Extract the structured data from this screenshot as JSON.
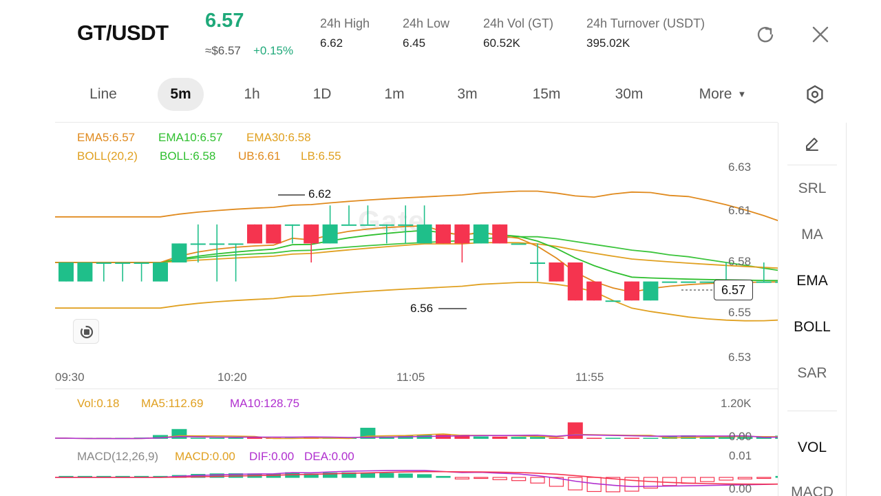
{
  "header": {
    "pair": "GT/USDT",
    "price": "6.57",
    "usd_price": "≈$6.57",
    "change": "+0.15%",
    "stats": [
      {
        "label": "24h   High",
        "value": "6.62"
      },
      {
        "label": "24h   Low",
        "value": "6.45"
      },
      {
        "label": "24h   Vol (GT)",
        "value": "60.52K"
      },
      {
        "label": "24h   Turnover (USDT)",
        "value": "395.02K"
      }
    ]
  },
  "tabs": [
    "Line",
    "5m",
    "1h",
    "1D",
    "1m",
    "3m",
    "15m",
    "30m",
    "More"
  ],
  "active_tab": "5m",
  "legend": {
    "row1": [
      "EMA5:6.57",
      "EMA10:6.57",
      "EMA30:6.58"
    ],
    "row2": [
      "BOLL(20,2)",
      "BOLL:6.58",
      "UB:6.61",
      "LB:6.55"
    ]
  },
  "price_axis": [
    "6.63",
    "6.61",
    "6.58",
    "6.55",
    "6.53"
  ],
  "time_axis": [
    "09:30",
    "10:20",
    "11:05",
    "11:55"
  ],
  "annotations": {
    "high": "6.62",
    "low": "6.56"
  },
  "current_price_tag": "6.57",
  "watermark": "Gate",
  "volume": {
    "legend": [
      "Vol:0.18",
      "MA5:112.69",
      "MA10:128.75"
    ],
    "axis": [
      "1.20K",
      "0.00"
    ]
  },
  "macd": {
    "legend": [
      "MACD(12,26,9)",
      "MACD:0.00",
      "DIF:0.00",
      "DEA:0.00"
    ],
    "axis": [
      "0.01",
      "0.00"
    ]
  },
  "side_panel": [
    "SRL",
    "MA",
    "EMA",
    "BOLL",
    "SAR",
    "VOL",
    "MACD"
  ],
  "side_active": [
    "EMA",
    "BOLL",
    "VOL"
  ],
  "colors": {
    "up": "#1fbf8a",
    "down": "#f5344f",
    "ema5": "#e08a1e",
    "ema10": "#2fbf2f",
    "ema30": "#e0a020",
    "boll": "#3cc43c",
    "ub": "#e08a1e",
    "lb": "#e0a020",
    "ma5": "#e0a020",
    "ma10": "#b02fcf",
    "macd_text": "#777",
    "accent": "#1fa97a"
  },
  "icons": [
    "refresh-icon",
    "close-icon",
    "settings-hexagon-icon",
    "pencil-icon",
    "rotate-icon"
  ],
  "chart_data": {
    "type": "candlestick",
    "interval": "5m",
    "candles": [
      {
        "o": 6.57,
        "c": 6.58,
        "h": 6.58,
        "l": 6.57
      },
      {
        "o": 6.57,
        "c": 6.58,
        "h": 6.58,
        "l": 6.57
      },
      {
        "o": 6.58,
        "c": 6.58,
        "h": 6.58,
        "l": 6.57
      },
      {
        "o": 6.58,
        "c": 6.58,
        "h": 6.58,
        "l": 6.57
      },
      {
        "o": 6.58,
        "c": 6.58,
        "h": 6.58,
        "l": 6.57
      },
      {
        "o": 6.57,
        "c": 6.58,
        "h": 6.58,
        "l": 6.57
      },
      {
        "o": 6.58,
        "c": 6.59,
        "h": 6.59,
        "l": 6.58
      },
      {
        "o": 6.59,
        "c": 6.59,
        "h": 6.6,
        "l": 6.58
      },
      {
        "o": 6.59,
        "c": 6.59,
        "h": 6.6,
        "l": 6.57
      },
      {
        "o": 6.59,
        "c": 6.59,
        "h": 6.59,
        "l": 6.57
      },
      {
        "o": 6.6,
        "c": 6.59,
        "h": 6.6,
        "l": 6.59
      },
      {
        "o": 6.6,
        "c": 6.59,
        "h": 6.6,
        "l": 6.59
      },
      {
        "o": 6.6,
        "c": 6.6,
        "h": 6.6,
        "l": 6.59
      },
      {
        "o": 6.6,
        "c": 6.59,
        "h": 6.6,
        "l": 6.58
      },
      {
        "o": 6.59,
        "c": 6.6,
        "h": 6.61,
        "l": 6.59
      },
      {
        "o": 6.6,
        "c": 6.6,
        "h": 6.61,
        "l": 6.6
      },
      {
        "o": 6.6,
        "c": 6.6,
        "h": 6.61,
        "l": 6.6
      },
      {
        "o": 6.6,
        "c": 6.6,
        "h": 6.6,
        "l": 6.59
      },
      {
        "o": 6.6,
        "c": 6.6,
        "h": 6.61,
        "l": 6.59
      },
      {
        "o": 6.59,
        "c": 6.6,
        "h": 6.61,
        "l": 6.59
      },
      {
        "o": 6.6,
        "c": 6.59,
        "h": 6.6,
        "l": 6.59
      },
      {
        "o": 6.6,
        "c": 6.59,
        "h": 6.6,
        "l": 6.58
      },
      {
        "o": 6.59,
        "c": 6.6,
        "h": 6.6,
        "l": 6.59
      },
      {
        "o": 6.6,
        "c": 6.59,
        "h": 6.6,
        "l": 6.59
      },
      {
        "o": 6.59,
        "c": 6.59,
        "h": 6.59,
        "l": 6.59
      },
      {
        "o": 6.58,
        "c": 6.58,
        "h": 6.59,
        "l": 6.57
      },
      {
        "o": 6.58,
        "c": 6.57,
        "h": 6.58,
        "l": 6.57
      },
      {
        "o": 6.58,
        "c": 6.56,
        "h": 6.58,
        "l": 6.56
      },
      {
        "o": 6.57,
        "c": 6.56,
        "h": 6.57,
        "l": 6.56
      },
      {
        "o": 6.56,
        "c": 6.56,
        "h": 6.56,
        "l": 6.56
      },
      {
        "o": 6.57,
        "c": 6.56,
        "h": 6.57,
        "l": 6.56
      },
      {
        "o": 6.56,
        "c": 6.57,
        "h": 6.57,
        "l": 6.56
      },
      {
        "o": 6.57,
        "c": 6.57,
        "h": 6.57,
        "l": 6.57
      },
      {
        "o": 6.57,
        "c": 6.57,
        "h": 6.57,
        "l": 6.57
      },
      {
        "o": 6.57,
        "c": 6.57,
        "h": 6.57,
        "l": 6.57
      },
      {
        "o": 6.57,
        "c": 6.57,
        "h": 6.58,
        "l": 6.57
      },
      {
        "o": 6.57,
        "c": 6.57,
        "h": 6.57,
        "l": 6.57
      },
      {
        "o": 6.57,
        "c": 6.57,
        "h": 6.58,
        "l": 6.57
      },
      {
        "o": 6.57,
        "c": 6.57,
        "h": 6.57,
        "l": 6.57
      },
      {
        "o": 6.57,
        "c": 6.57,
        "h": 6.58,
        "l": 6.57
      }
    ],
    "volume": [
      20,
      0,
      5,
      0,
      40,
      120,
      310,
      0,
      0,
      0,
      60,
      0,
      0,
      60,
      0,
      0,
      350,
      70,
      100,
      120,
      130,
      130,
      75,
      70,
      60,
      60,
      0,
      520,
      20,
      0,
      20,
      0,
      100,
      110,
      60,
      60,
      60,
      60,
      100,
      0
    ],
    "ylim": [
      6.53,
      6.63
    ],
    "vol_ylim": [
      0,
      1200
    ]
  }
}
